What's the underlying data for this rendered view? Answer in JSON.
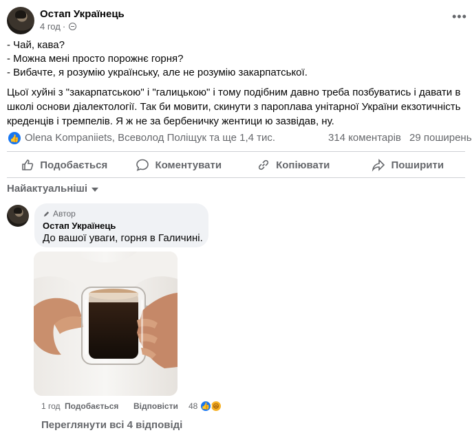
{
  "post": {
    "author": "Остап Українець",
    "time": "4 год",
    "privacy_icon": "globe-icon",
    "more_icon": "more-horizontal-icon",
    "dialogue_lines": [
      "- Чай, кава?",
      "- Можна мені просто порожнє горня?",
      "- Вибачте, я розумію українську, але не розумію закарпатської."
    ],
    "paragraph": "Цьої хуйні з \"закарпатською\" і \"галицькою\" і тому подібним давно треба позбуватись і давати в школі основи діалектології. Так би мовити, скинути з пароплава унітарної України екзотичність креденців і тремпелів. Я ж не за бербеничку жентици ю зазвідав, ну.",
    "reactors": "Olena Kompaniiets, Всеволод Поліщук та ще 1,4 тис.",
    "comments_count": "314 коментарів",
    "shares_count": "29 поширень"
  },
  "actions": {
    "like": "Подобається",
    "comment": "Коментувати",
    "copy": "Копіювати",
    "share": "Поширити"
  },
  "sort_label": "Найактуальніші",
  "comment": {
    "badge": "Автор",
    "author": "Остап Українець",
    "text": "До вашої уваги, горня в Галичині.",
    "time": "1 год",
    "like": "Подобається",
    "reply": "Відповісти",
    "reactions": "48"
  },
  "view_replies": "Переглянути всі 4 відповіді",
  "colors": {
    "accent": "#1877f2",
    "muted_text": "#65676b",
    "bubble_bg": "#f0f2f5",
    "haha": "#f7b125"
  }
}
